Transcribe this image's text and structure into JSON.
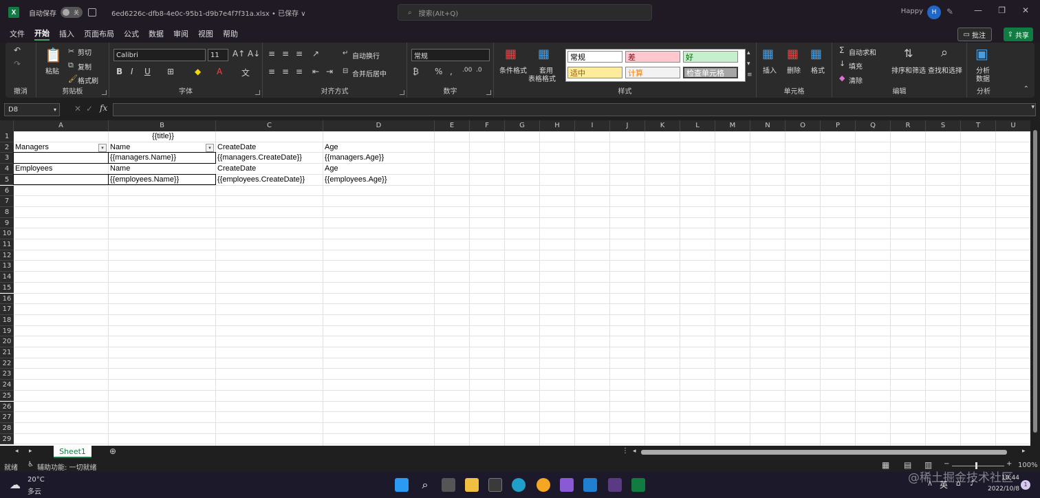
{
  "titlebar": {
    "autosave_label": "自动保存",
    "autosave_state": "关",
    "filename": "6ed6226c-dfb8-4e0c-95b1-d9b7e4f7f31a.xlsx • 已保存 ∨",
    "search_placeholder": "搜索(Alt+Q)",
    "user_name": "Happy",
    "user_initial": "H"
  },
  "menu": {
    "items": [
      "文件",
      "开始",
      "插入",
      "页面布局",
      "公式",
      "数据",
      "审阅",
      "视图",
      "帮助"
    ],
    "comment_label": "批注",
    "share_label": "共享"
  },
  "ribbon": {
    "undo_label": "撤消",
    "clipboard": {
      "label": "剪贴板",
      "paste": "粘贴",
      "cut": "剪切",
      "copy": "复制",
      "format_painter": "格式刷"
    },
    "font": {
      "label": "字体",
      "name": "Calibri",
      "size": "11"
    },
    "alignment": {
      "label": "对齐方式",
      "wrap": "自动换行",
      "merge": "合并后居中"
    },
    "number": {
      "label": "数字",
      "format": "常规"
    },
    "styles": {
      "label": "样式",
      "conditional": "条件格式",
      "table_format_1": "套用",
      "table_format_2": "表格格式",
      "cells": [
        "常规",
        "差",
        "好",
        "适中",
        "计算",
        "检查单元格"
      ]
    },
    "cells_group": {
      "label": "单元格",
      "insert": "插入",
      "delete": "删除",
      "format": "格式"
    },
    "editing": {
      "label": "编辑",
      "autosum": "自动求和",
      "fill": "填充",
      "clear": "清除",
      "sort_filter": "排序和筛选",
      "find_select": "查找和选择"
    },
    "analysis": {
      "label": "分析",
      "analyze_1": "分析",
      "analyze_2": "数据"
    }
  },
  "formula_bar": {
    "name_box": "D8",
    "fx": "fx",
    "value": ""
  },
  "grid": {
    "columns": [
      "A",
      "B",
      "C",
      "D",
      "E",
      "F",
      "G",
      "H",
      "I",
      "J",
      "K",
      "L",
      "M",
      "N",
      "O",
      "P",
      "Q",
      "R",
      "S",
      "T",
      "U"
    ],
    "rows": [
      "1",
      "2",
      "3",
      "4",
      "5",
      "6",
      "7",
      "8",
      "9",
      "10",
      "11",
      "12",
      "13",
      "14",
      "15",
      "16",
      "17",
      "18",
      "19",
      "20",
      "21",
      "22",
      "23",
      "24",
      "25",
      "26",
      "27",
      "28",
      "29"
    ],
    "cells": {
      "B1": "{{title}}",
      "A2": "Managers",
      "B2": "Name",
      "C2": "CreateDate",
      "D2": "Age",
      "B3": "{{managers.Name}}",
      "C3": "{{managers.CreateDate}}",
      "D3": "{{managers.Age}}",
      "A4": "Employees",
      "B4": "Name",
      "C4": "CreateDate",
      "D4": "Age",
      "B5": "{{employees.Name}}",
      "C5": "{{employees.CreateDate}}",
      "D5": "{{employees.Age}}"
    }
  },
  "sheets": {
    "active": "Sheet1"
  },
  "status": {
    "ready": "就绪",
    "accessibility": "辅助功能: 一切就绪",
    "zoom": "100%"
  },
  "taskbar": {
    "temp": "20°C",
    "weather": "多云",
    "ime": "英",
    "time": "10:44",
    "date": "2022/10/8",
    "watermark": "@稀土掘金技术社区",
    "notif_count": "1"
  },
  "colors": {
    "accent": "#107c41",
    "window_bg": "#1f1a24",
    "ribbon_bg": "#2b2b2b"
  }
}
